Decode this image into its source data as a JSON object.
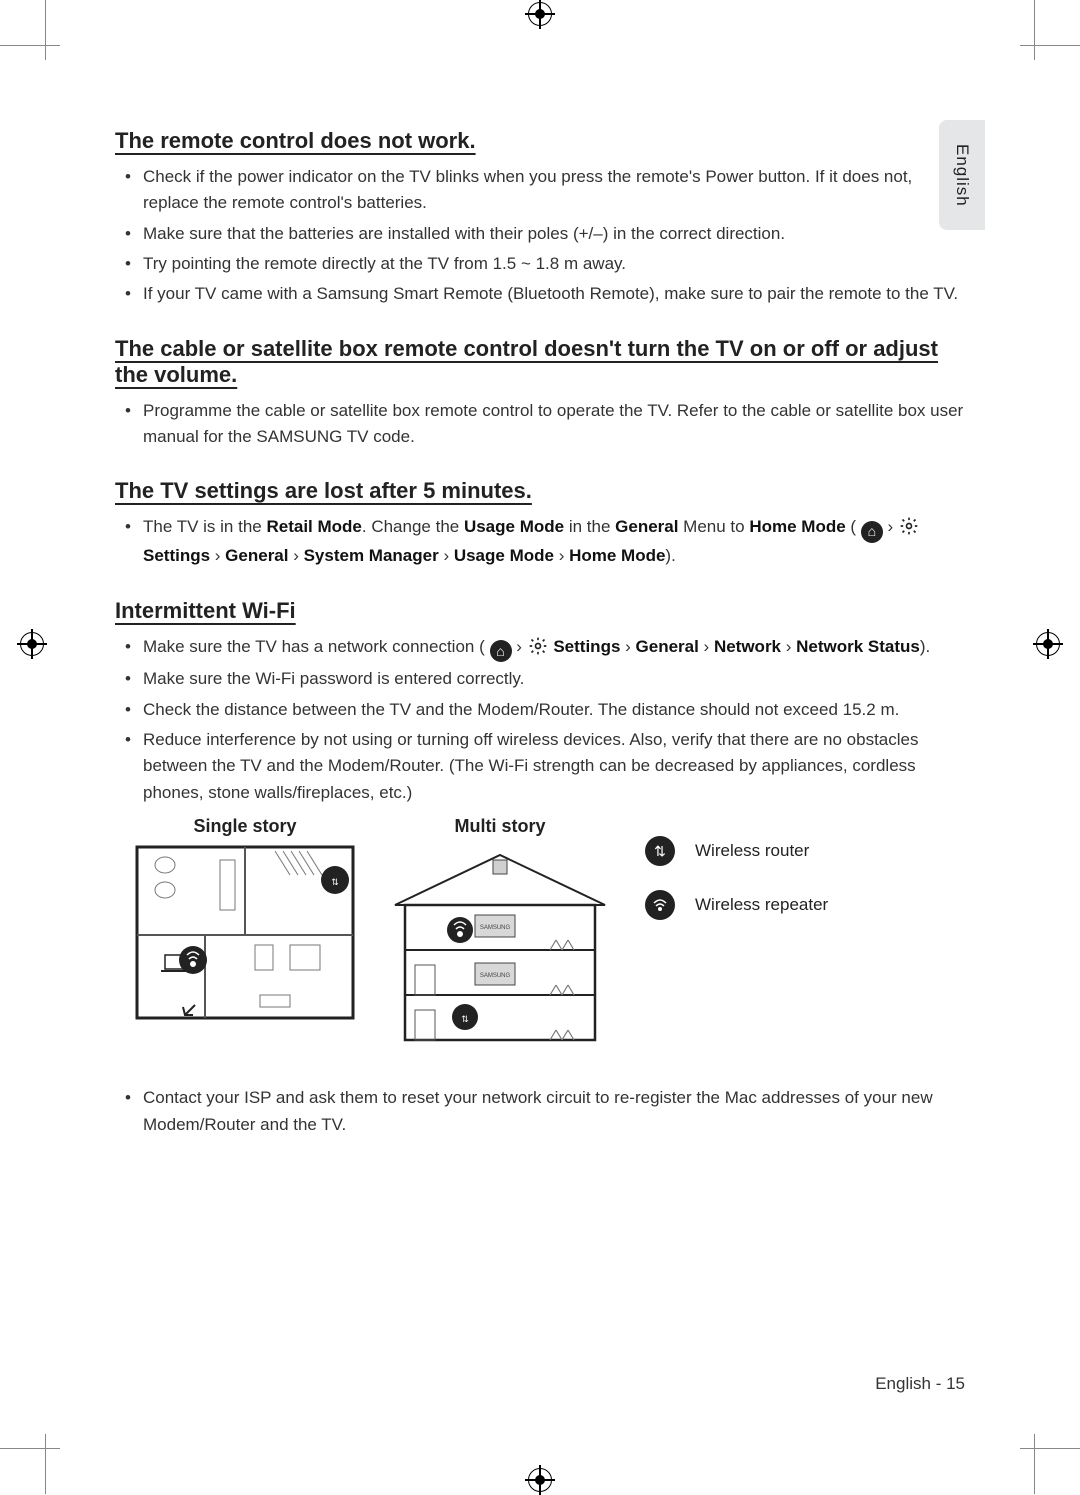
{
  "langTab": "English",
  "sections": {
    "remote": {
      "heading": "The remote control does not work.",
      "items": [
        "Check if the power indicator on the TV blinks when you press the remote's Power button. If it does not, replace the remote control's batteries.",
        "Make sure that the batteries are installed with their poles (+/–) in the correct direction.",
        "Try pointing the remote directly at the TV from 1.5 ~ 1.8 m away.",
        "If your TV came with a Samsung Smart Remote (Bluetooth Remote), make sure to pair the remote to the TV."
      ]
    },
    "cable": {
      "heading": "The cable or satellite box remote control doesn't turn the TV on or off or adjust the volume.",
      "items": [
        "Programme the cable or satellite box remote control to operate the TV. Refer to the cable or satellite box user manual for the SAMSUNG TV code."
      ]
    },
    "settings": {
      "heading": "The TV settings are lost after 5 minutes.",
      "prefix": "The TV is in the ",
      "retail": "Retail Mode",
      "mid1": ". Change the ",
      "usage": "Usage Mode",
      "mid2": " in the ",
      "general": "General",
      "mid3": " Menu to ",
      "home": "Home Mode",
      "open": " (",
      "sep": " › ",
      "settingsLabel": "Settings",
      "path2": "General",
      "path3": "System Manager",
      "path4": "Usage Mode",
      "path5": "Home Mode",
      "close": ")."
    },
    "wifi": {
      "heading": "Intermittent Wi-Fi",
      "item1_prefix": "Make sure the TV has a network connection (",
      "item1_sep": " › ",
      "item1_settings": "Settings",
      "item1_general": "General",
      "item1_network": "Network",
      "item1_status": "Network Status",
      "item1_close": ").",
      "item2": "Make sure the Wi-Fi password is entered correctly.",
      "item3": "Check the distance between the TV and the Modem/Router. The distance should not exceed 15.2 m.",
      "item4": "Reduce interference by not using or turning off wireless devices. Also, verify that there are no obstacles between the TV and the Modem/Router. (The Wi-Fi strength can be decreased by appliances, cordless phones, stone walls/fireplaces, etc.)",
      "single": "Single story",
      "multi": "Multi story",
      "legend_router": "Wireless router",
      "legend_repeater": "Wireless repeater",
      "item5": "Contact your ISP and ask them to reset your network circuit to re-register the Mac addresses of your new Modem/Router and the TV."
    }
  },
  "footer": "English - 15"
}
